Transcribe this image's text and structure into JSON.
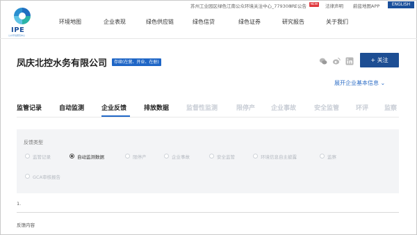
{
  "top_bar": {
    "location_text": "苏州工业园区绿色江南公众环境关注中心_779308 ⌄",
    "ipe_notice": "IPE公告",
    "new_badge": "NEW",
    "legal": "法律声明",
    "app": "蔚蓝地图APP",
    "english": "ENGLISH"
  },
  "logo": {
    "text": "IPE",
    "subtitle": "公众环境研究中心",
    "colors": [
      "#1f6fc0",
      "#2bb3a7",
      "#5fc3e4"
    ]
  },
  "nav": {
    "items": [
      "环境地图",
      "企业表现",
      "绿色供应链",
      "绿色信贷",
      "绿色证券",
      "研究报告",
      "关于我们"
    ]
  },
  "company": {
    "name": "凤庆北控水务有限公司",
    "status": "存续(在营、开业、在册)",
    "follow_label": "+ 关注",
    "expand_label": "展开企业基本信息 ⌄",
    "social_icons": [
      "wechat-icon",
      "weibo-icon",
      "linkedin-icon"
    ]
  },
  "tabs": [
    {
      "label": "监管记录",
      "active": false,
      "enabled": true
    },
    {
      "label": "自动监测",
      "active": false,
      "enabled": true
    },
    {
      "label": "企业反馈",
      "active": true,
      "enabled": true
    },
    {
      "label": "排放数据",
      "active": false,
      "enabled": true
    },
    {
      "label": "监督性监测",
      "active": false,
      "enabled": false
    },
    {
      "label": "限停产",
      "active": false,
      "enabled": false
    },
    {
      "label": "企业事故",
      "active": false,
      "enabled": false
    },
    {
      "label": "安全监管",
      "active": false,
      "enabled": false
    },
    {
      "label": "环评",
      "active": false,
      "enabled": false
    },
    {
      "label": "监察",
      "active": false,
      "enabled": false
    }
  ],
  "feedback": {
    "type_label": "反馈类型",
    "options": [
      {
        "label": "监管记录",
        "selected": false
      },
      {
        "label": "自动监测数据",
        "selected": true
      },
      {
        "label": "限停产",
        "selected": false
      },
      {
        "label": "企业事故",
        "selected": false
      },
      {
        "label": "安全监管",
        "selected": false
      },
      {
        "label": "环境信息自主披露",
        "selected": false
      },
      {
        "label": "监察",
        "selected": false
      },
      {
        "label": "GCA审核报告",
        "selected": false
      }
    ],
    "item_number": "1.",
    "content_label": "反馈内容"
  },
  "colors": {
    "brand_blue": "#1d4e93",
    "accent_blue": "#1f66c6",
    "link_blue": "#2f6fc7",
    "badge_red": "#e0393e"
  }
}
